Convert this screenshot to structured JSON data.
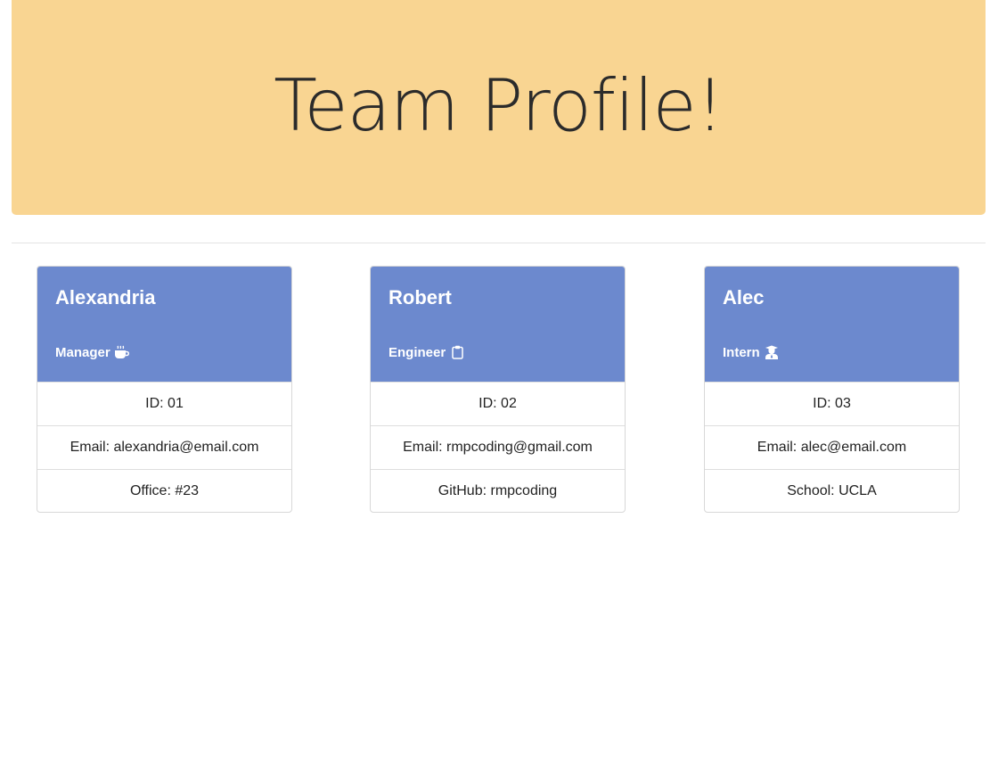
{
  "header": {
    "title": "Team Profile!"
  },
  "colors": {
    "jumbotron": "#f9d592",
    "card_header": "#6c89ce"
  },
  "employees": [
    {
      "name": "Alexandria",
      "role": "Manager",
      "role_icon": "coffee-icon",
      "id": "ID: 01",
      "email": "Email: alexandria@email.com",
      "extra": "Office: #23"
    },
    {
      "name": "Robert",
      "role": "Engineer",
      "role_icon": "clipboard-icon",
      "id": "ID: 02",
      "email": "Email: rmpcoding@gmail.com",
      "extra": "GitHub: rmpcoding"
    },
    {
      "name": "Alec",
      "role": "Intern",
      "role_icon": "graduate-icon",
      "id": "ID: 03",
      "email": "Email: alec@email.com",
      "extra": "School: UCLA"
    }
  ]
}
